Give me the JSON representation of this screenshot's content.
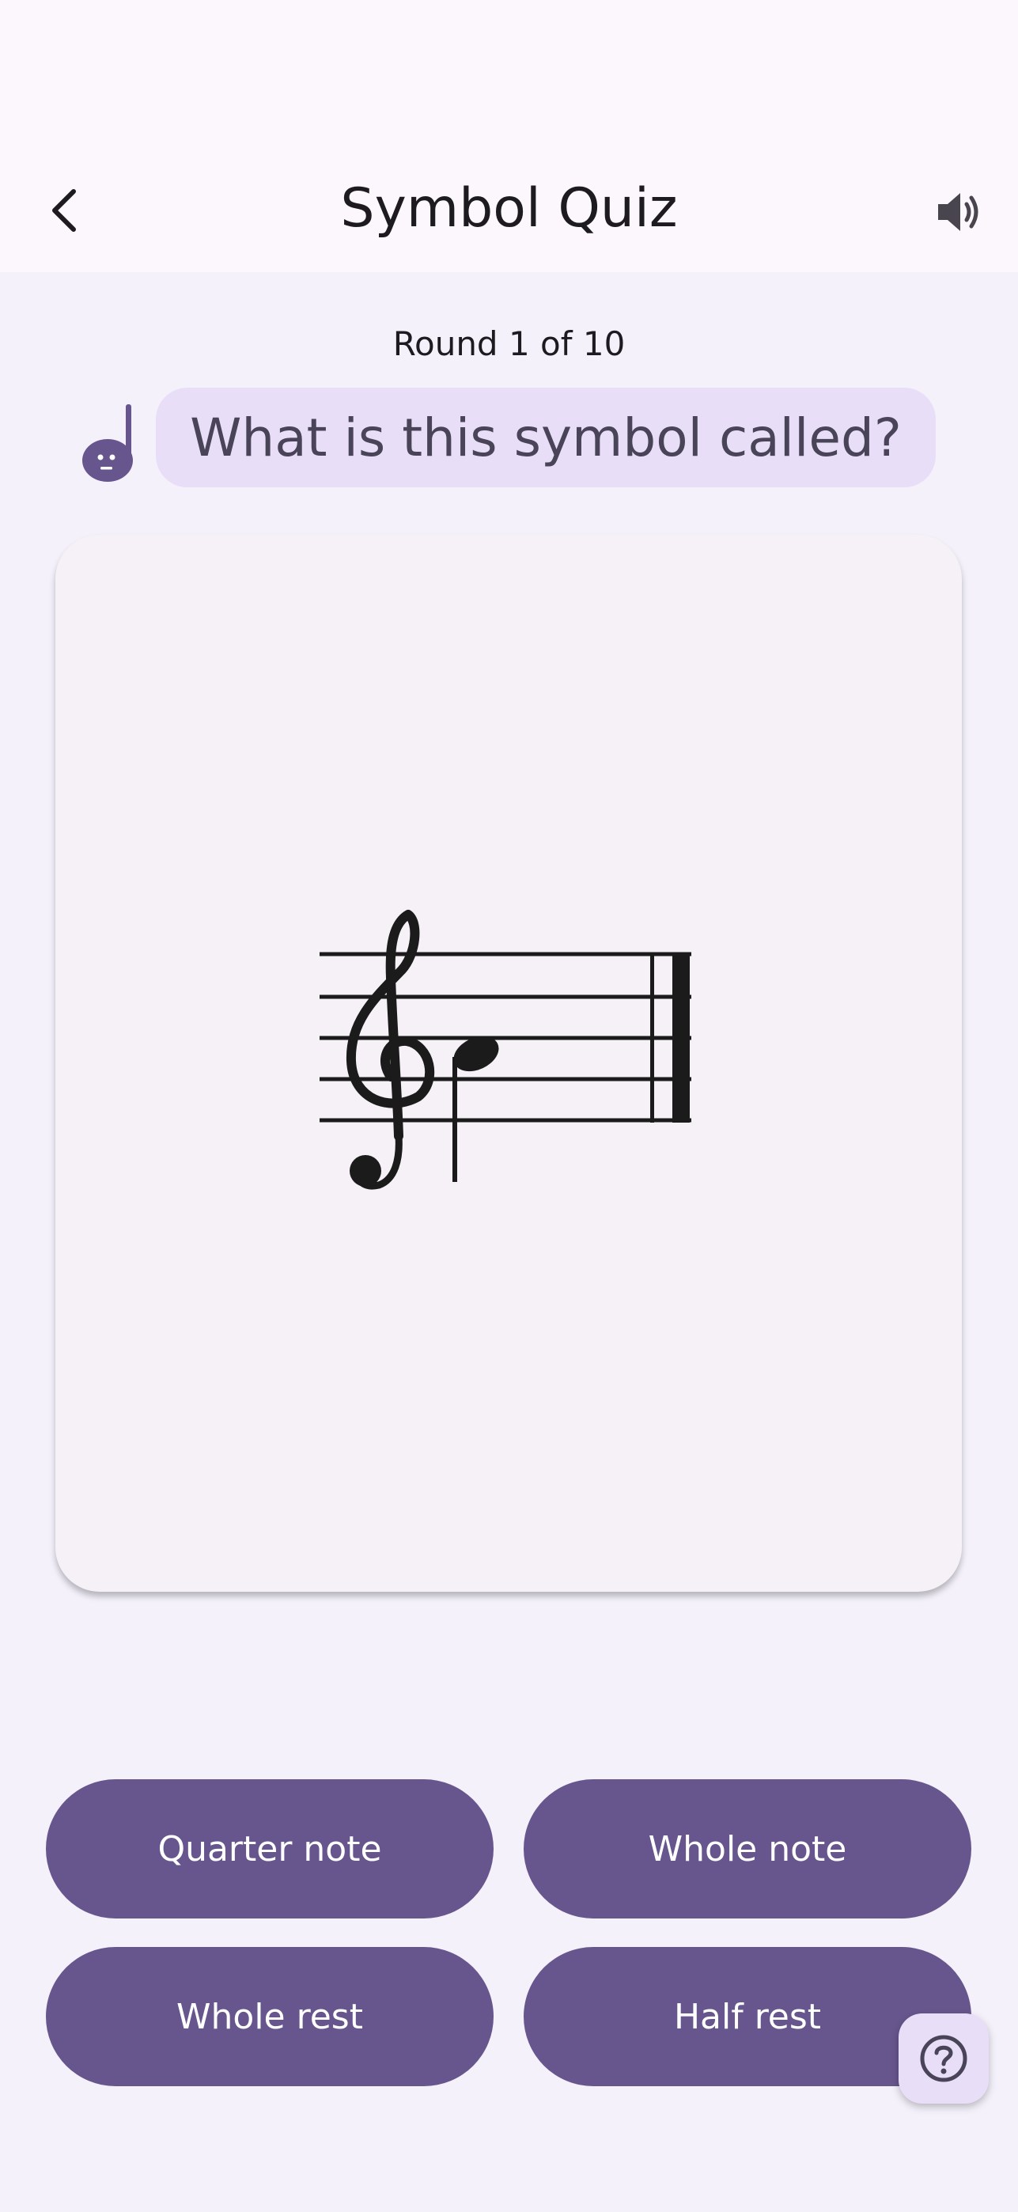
{
  "app_bar": {
    "title": "Symbol Quiz",
    "back_icon": "chevron-left-icon",
    "sound_icon": "speaker-icon"
  },
  "quiz": {
    "round_label": "Round 1 of 10",
    "prompt": "What is this symbol called?",
    "mascot_icon": "music-note-mascot-icon",
    "symbol_shown": "treble clef staff with quarter note"
  },
  "answers": [
    {
      "label": "Quarter note"
    },
    {
      "label": "Whole note"
    },
    {
      "label": "Whole rest"
    },
    {
      "label": "Half rest"
    }
  ],
  "help": {
    "icon": "help-icon"
  },
  "colors": {
    "background": "#f4f1fb",
    "app_bar": "#fcf7fc",
    "accent": "#67568d",
    "bubble": "#e8def8",
    "card": "#f6f1f7"
  }
}
